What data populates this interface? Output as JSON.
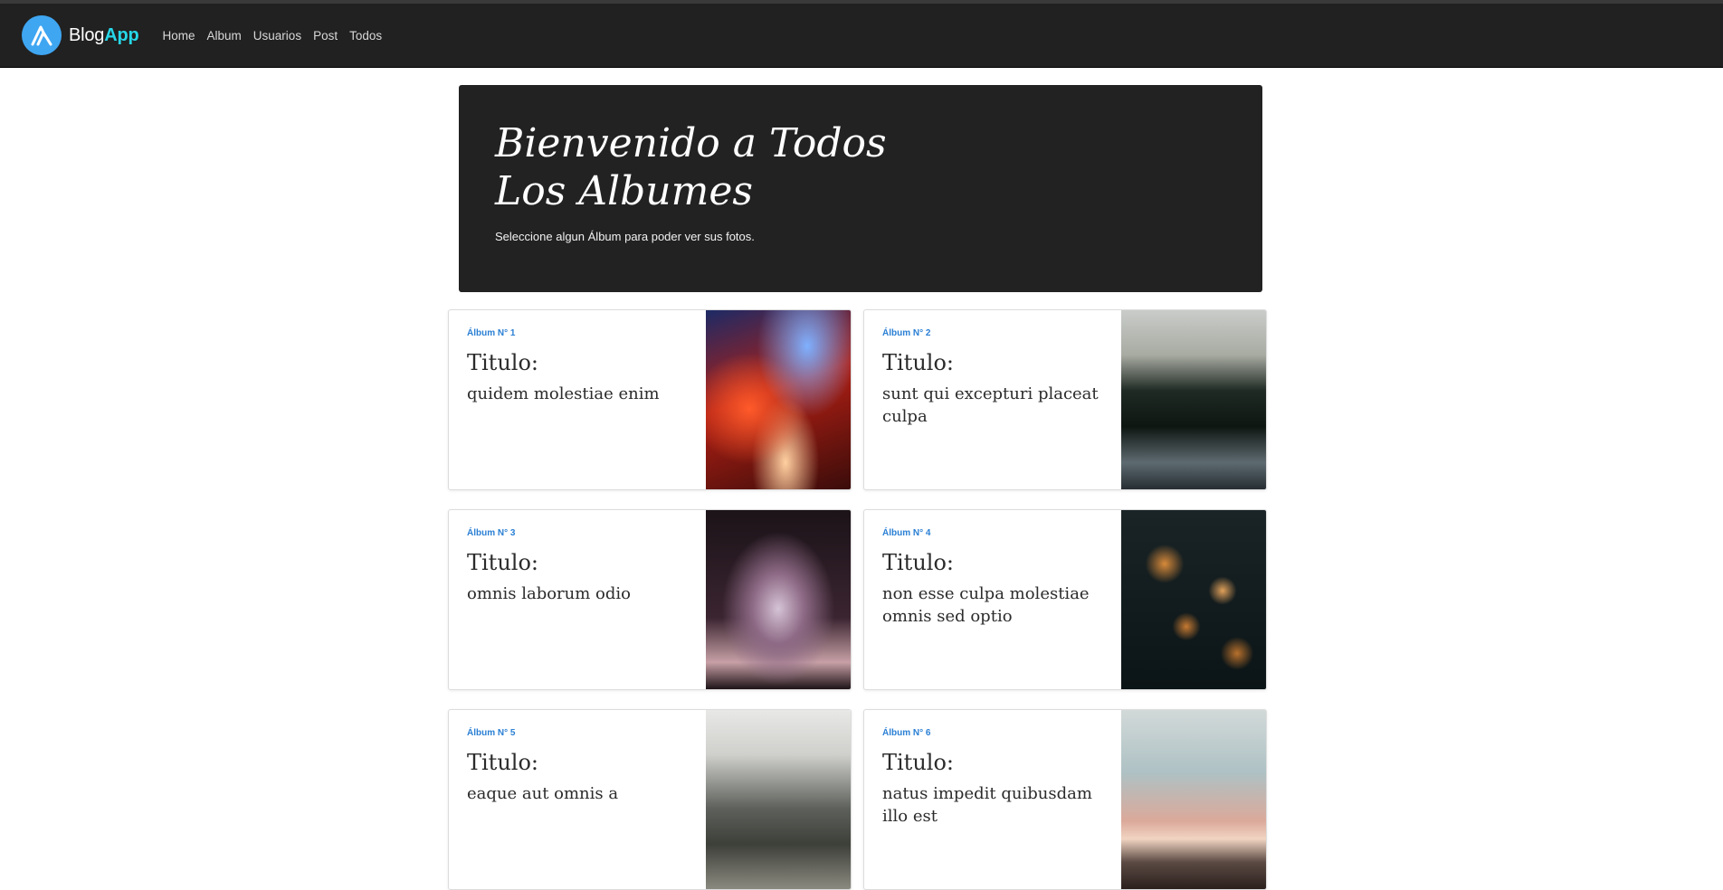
{
  "navbar": {
    "brand_part1": "Blog",
    "brand_part2": "App",
    "links": [
      "Home",
      "Album",
      "Usuarios",
      "Post",
      "Todos"
    ]
  },
  "hero": {
    "title": "Bienvenido a Todos Los Albumes",
    "subtitle": "Seleccione algun Álbum para poder ver sus fotos."
  },
  "albums": [
    {
      "number": "Álbum N° 1",
      "label": "Titulo:",
      "name": "quidem molestiae enim"
    },
    {
      "number": "Álbum N° 2",
      "label": "Titulo:",
      "name": "sunt qui excepturi placeat culpa"
    },
    {
      "number": "Álbum N° 3",
      "label": "Titulo:",
      "name": "omnis laborum odio"
    },
    {
      "number": "Álbum N° 4",
      "label": "Titulo:",
      "name": "non esse culpa molestiae omnis sed optio"
    },
    {
      "number": "Álbum N° 5",
      "label": "Titulo:",
      "name": "eaque aut omnis a"
    },
    {
      "number": "Álbum N° 6",
      "label": "Titulo:",
      "name": "natus impedit quibusdam illo est"
    }
  ],
  "colors": {
    "navbar_bg": "#212121",
    "brand_accent": "#26d7e8",
    "logo_bg": "#3fa6f2",
    "album_number": "#2a7fd4"
  }
}
